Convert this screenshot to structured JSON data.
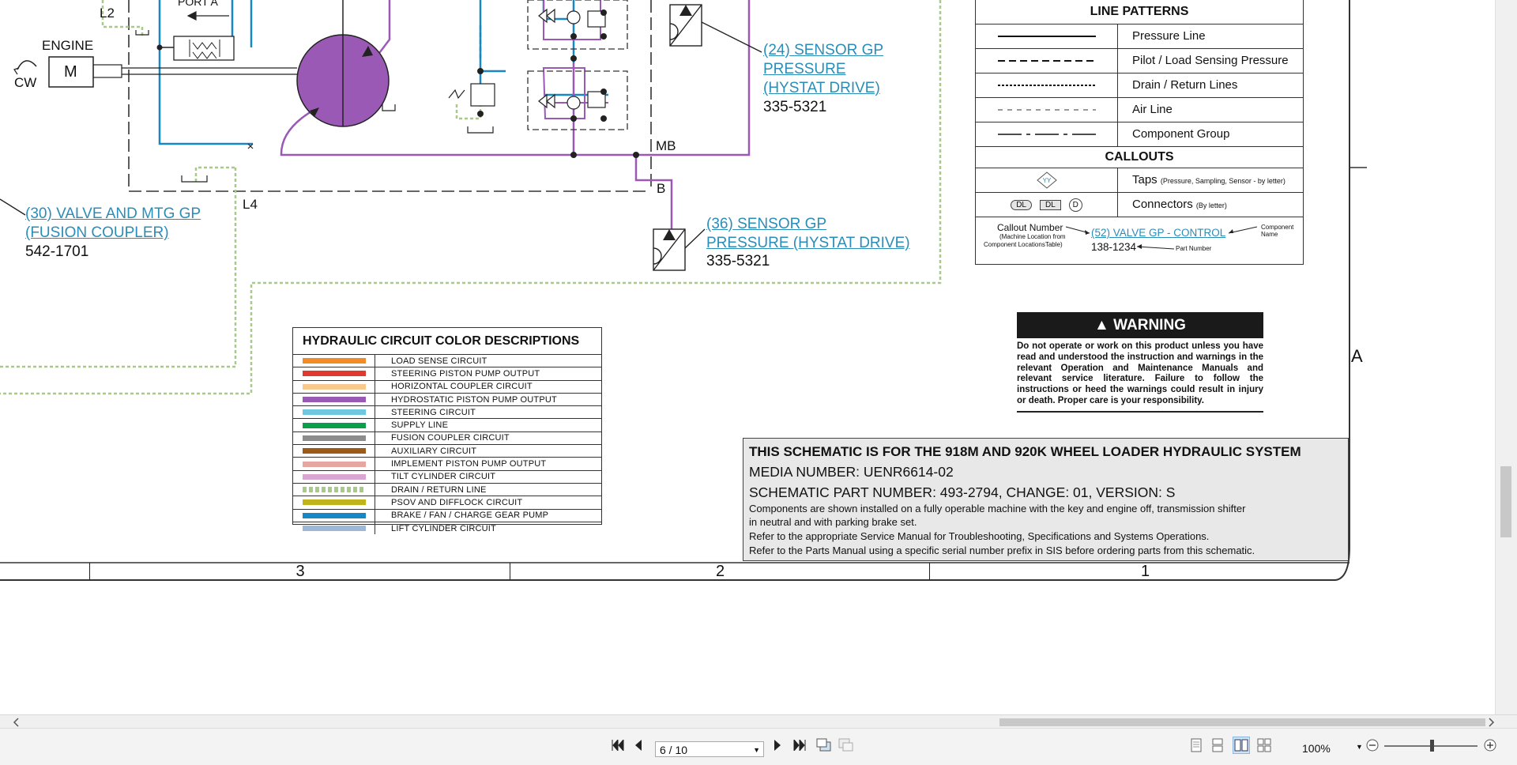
{
  "schematic": {
    "labels": {
      "l2": "L2",
      "port_a": "PORT A",
      "engine": "ENGINE",
      "motor": "M",
      "cw": "CW",
      "mb": "MB",
      "b": "B",
      "l4": "L4",
      "zone_a": "A"
    },
    "callouts": [
      {
        "number": "(24)",
        "name_line1": "SENSOR GP",
        "name_line2": "PRESSURE",
        "name_line3": "(HYSTAT DRIVE)",
        "part": "335-5321"
      },
      {
        "number": "(30)",
        "name_line1": "VALVE AND MTG GP",
        "name_line2": "(FUSION COUPLER)",
        "part": "542-1701"
      },
      {
        "number": "(36)",
        "name_line1": "SENSOR GP",
        "name_line2": "PRESSURE (HYSTAT DRIVE)",
        "part": "335-5321"
      }
    ]
  },
  "legend": {
    "line_patterns_title": "LINE PATTERNS",
    "rows": [
      "Pressure Line",
      "Pilot / Load Sensing Pressure",
      "Drain / Return Lines",
      "Air Line",
      "Component Group"
    ],
    "callouts_title": "CALLOUTS",
    "taps_label": "Taps",
    "taps_sub": "(Pressure, Sampling, Sensor - by letter)",
    "taps_symbol": "YY",
    "connectors_label": "Connectors",
    "connectors_sub": "(By letter)",
    "connector_symbols": [
      "DL",
      "DL",
      "D"
    ],
    "example": {
      "callout_number_label": "Callout Number",
      "callout_number_sub1": "(Machine Location from",
      "callout_number_sub2": "Component LocationsTable)",
      "link": "(52) VALVE GP - CONTROL",
      "component_label1": "Component",
      "component_label2": "Name",
      "part": "138-1234",
      "part_label": "Part Number"
    }
  },
  "color_table": {
    "title": "HYDRAULIC CIRCUIT COLOR DESCRIPTIONS",
    "rows": [
      {
        "label": "LOAD SENSE CIRCUIT",
        "color": "#f28c28"
      },
      {
        "label": "STEERING PISTON PUMP OUTPUT",
        "color": "#e03a2f"
      },
      {
        "label": "HORIZONTAL COUPLER CIRCUIT",
        "color": "#f9c98e"
      },
      {
        "label": "HYDROSTATIC PISTON PUMP OUTPUT",
        "color": "#9b59b6"
      },
      {
        "label": "STEERING CIRCUIT",
        "color": "#6fc7e0"
      },
      {
        "label": "SUPPLY LINE",
        "color": "#0a9f4a"
      },
      {
        "label": "FUSION COUPLER CIRCUIT",
        "color": "#8c8c8c"
      },
      {
        "label": "AUXILIARY CIRCUIT",
        "color": "#9c5a18"
      },
      {
        "label": "IMPLEMENT PISTON PUMP OUTPUT",
        "color": "#e6a7a0"
      },
      {
        "label": "TILT CYLINDER CIRCUIT",
        "color": "#d9a6d4"
      },
      {
        "label": "DRAIN / RETURN LINE",
        "color": "#a8c98a",
        "dotted": true
      },
      {
        "label": "PSOV AND DIFFLOCK CIRCUIT",
        "color": "#c0b41a"
      },
      {
        "label": "BRAKE / FAN / CHARGE GEAR PUMP",
        "color": "#1788c4"
      },
      {
        "label": "LIFT CYLINDER CIRCUIT",
        "color": "#9fb8d6"
      }
    ]
  },
  "warning": {
    "title": "WARNING",
    "text": "Do not operate or work on this product unless you have read and understood the instruction and warnings in the relevant Operation and Maintenance Manuals and relevant service literature. Failure to follow the instructions or heed the warnings could result in injury or death. Proper care is your responsibility."
  },
  "info": {
    "title": "THIS SCHEMATIC IS FOR THE 918M AND 920K WHEEL LOADER HYDRAULIC SYSTEM",
    "media": "MEDIA NUMBER: UENR6614-02",
    "part": "SCHEMATIC PART NUMBER: 493-2794, CHANGE: 01, VERSION: S",
    "notes": [
      "Components are shown installed on a fully operable machine with the key and engine off, transmission shifter",
      "in neutral and with parking brake set.",
      "Refer to the appropriate Service Manual for Troubleshooting, Specifications and Systems Operations.",
      "Refer to the Parts Manual using a specific serial number prefix in SIS before ordering parts from this schematic."
    ]
  },
  "zones": [
    "3",
    "2",
    "1"
  ],
  "toolbar": {
    "page_display": "6 / 10",
    "zoom": "100%"
  }
}
